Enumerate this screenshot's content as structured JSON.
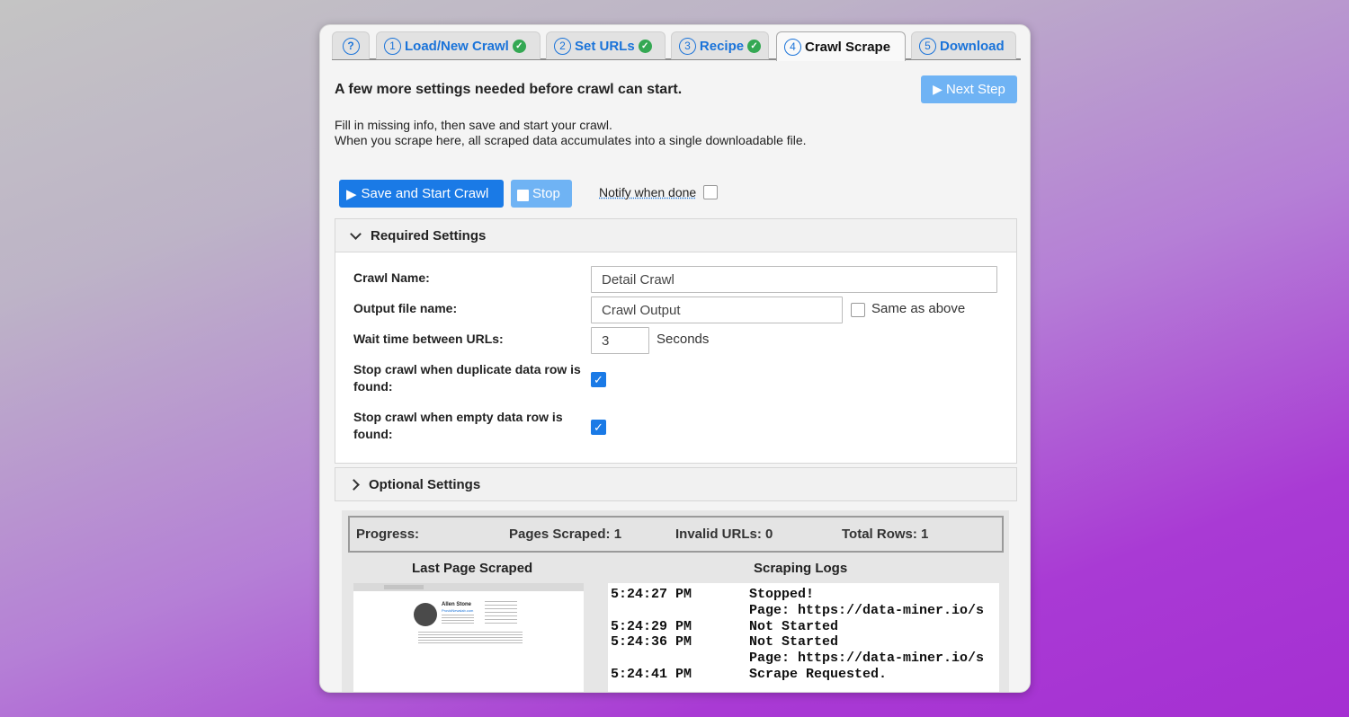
{
  "tabs": [
    {
      "num": "",
      "label": "",
      "icon": "help-circle-icon",
      "done": false
    },
    {
      "num": "1",
      "label": "Load/New Crawl",
      "done": true
    },
    {
      "num": "2",
      "label": "Set URLs",
      "done": true
    },
    {
      "num": "3",
      "label": "Recipe",
      "done": true
    },
    {
      "num": "4",
      "label": "Crawl Scrape",
      "done": false,
      "active": true
    },
    {
      "num": "5",
      "label": "Download",
      "done": false
    }
  ],
  "heading": "A few more settings needed before crawl can start.",
  "next_step_label": "Next Step",
  "description": [
    "Fill in missing info, then save and start your crawl.",
    "When you scrape here, all scraped data accumulates into a single downloadable file."
  ],
  "actions": {
    "start_label": "Save and Start Crawl",
    "stop_label": "Stop",
    "notify_label": "Notify when done",
    "notify_checked": false
  },
  "required": {
    "title": "Required Settings",
    "crawl_name_label": "Crawl Name:",
    "crawl_name_value": "Detail Crawl",
    "output_label": "Output file name:",
    "output_value": "Crawl Output",
    "same_as_above_label": "Same as above",
    "same_as_above_checked": false,
    "wait_label": "Wait time between URLs:",
    "wait_value": "3",
    "wait_unit": "Seconds",
    "dup_label": "Stop crawl when duplicate data row is found:",
    "dup_checked": true,
    "empty_label": "Stop crawl when empty data row is found:",
    "empty_checked": true
  },
  "optional": {
    "title": "Optional Settings"
  },
  "progress": {
    "label": "Progress:",
    "pages": "Pages Scraped: 1",
    "invalid": "Invalid URLs: 0",
    "rows": "Total Rows: 1"
  },
  "last_page_title": "Last Page Scraped",
  "thumb": {
    "name": "Allen Stone",
    "subtitle": "ProvidNewslab.com"
  },
  "logs_title": "Scraping Logs",
  "logs": [
    {
      "time": "5:24:27 PM",
      "msg": "Stopped!"
    },
    {
      "time": "",
      "msg": "Page: https://data-miner.io/s"
    },
    {
      "time": "5:24:29 PM",
      "msg": "Not Started"
    },
    {
      "time": "5:24:36 PM",
      "msg": "Not Started"
    },
    {
      "time": "",
      "msg": "Page: https://data-miner.io/s"
    },
    {
      "time": "5:24:41 PM",
      "msg": "Scrape Requested."
    }
  ],
  "colors": {
    "accent": "#1a7ae6",
    "accent_light": "#6fb3f4",
    "done_green": "#34a853"
  }
}
